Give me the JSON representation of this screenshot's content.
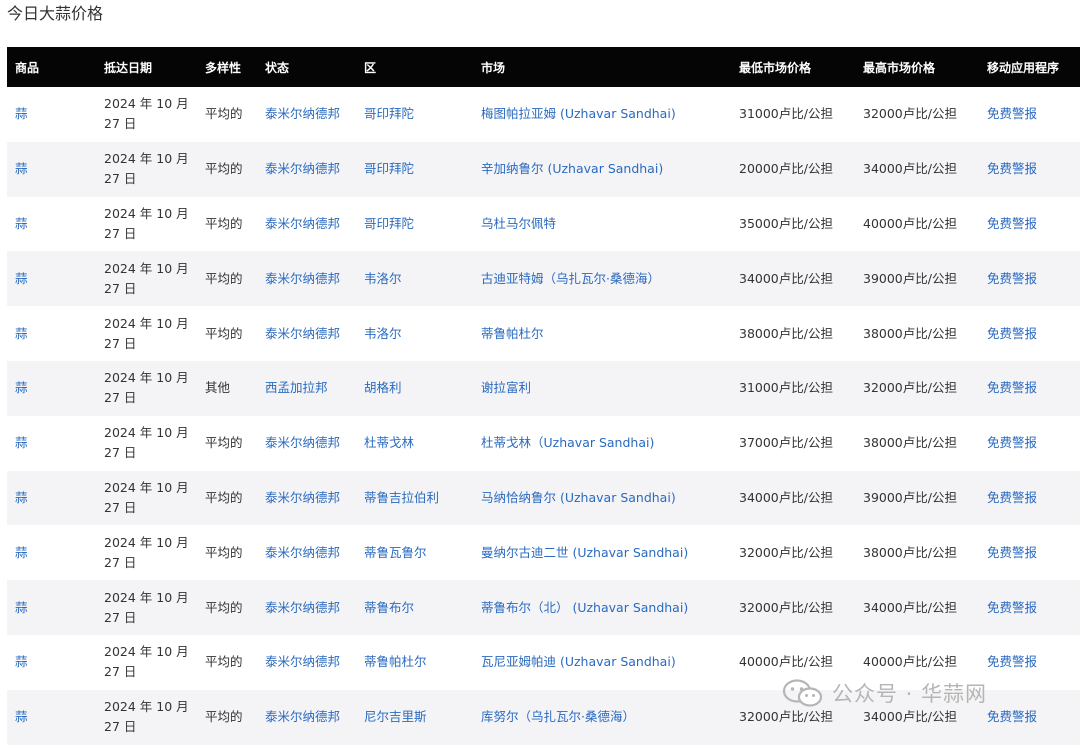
{
  "page": {
    "title": "今日大蒜价格"
  },
  "table": {
    "headers": [
      "商品",
      "抵达日期",
      "多样性",
      "状态",
      "区",
      "市场",
      "最低市场价格",
      "最高市场价格",
      "移动应用程序"
    ],
    "rows": [
      {
        "commodity": "蒜",
        "date": "2024 年 10 月 27 日",
        "variety": "平均的",
        "state": "泰米尔纳德邦",
        "district": "哥印拜陀",
        "market": "梅图帕拉亚姆 (Uzhavar Sandhai)",
        "min": "31000卢比/公担",
        "max": "32000卢比/公担",
        "app": "免费警报"
      },
      {
        "commodity": "蒜",
        "date": "2024 年 10 月 27 日",
        "variety": "平均的",
        "state": "泰米尔纳德邦",
        "district": "哥印拜陀",
        "market": "辛加纳鲁尔 (Uzhavar Sandhai)",
        "min": "20000卢比/公担",
        "max": "34000卢比/公担",
        "app": "免费警报"
      },
      {
        "commodity": "蒜",
        "date": "2024 年 10 月 27 日",
        "variety": "平均的",
        "state": "泰米尔纳德邦",
        "district": "哥印拜陀",
        "market": "乌杜马尔佩特",
        "min": "35000卢比/公担",
        "max": "40000卢比/公担",
        "app": "免费警报"
      },
      {
        "commodity": "蒜",
        "date": "2024 年 10 月 27 日",
        "variety": "平均的",
        "state": "泰米尔纳德邦",
        "district": "韦洛尔",
        "market": "古迪亚特姆（乌扎瓦尔·桑德海）",
        "min": "34000卢比/公担",
        "max": "39000卢比/公担",
        "app": "免费警报"
      },
      {
        "commodity": "蒜",
        "date": "2024 年 10 月 27 日",
        "variety": "平均的",
        "state": "泰米尔纳德邦",
        "district": "韦洛尔",
        "market": "蒂鲁帕杜尔",
        "min": "38000卢比/公担",
        "max": "38000卢比/公担",
        "app": "免费警报"
      },
      {
        "commodity": "蒜",
        "date": "2024 年 10 月 27 日",
        "variety": "其他",
        "state": "西孟加拉邦",
        "district": "胡格利",
        "market": "谢拉富利",
        "min": "31000卢比/公担",
        "max": "32000卢比/公担",
        "app": "免费警报"
      },
      {
        "commodity": "蒜",
        "date": "2024 年 10 月 27 日",
        "variety": "平均的",
        "state": "泰米尔纳德邦",
        "district": "杜蒂戈林",
        "market": "杜蒂戈林（Uzhavar Sandhai)",
        "min": "37000卢比/公担",
        "max": "38000卢比/公担",
        "app": "免费警报"
      },
      {
        "commodity": "蒜",
        "date": "2024 年 10 月 27 日",
        "variety": "平均的",
        "state": "泰米尔纳德邦",
        "district": "蒂鲁吉拉伯利",
        "market": "马纳恰纳鲁尔 (Uzhavar Sandhai)",
        "min": "34000卢比/公担",
        "max": "39000卢比/公担",
        "app": "免费警报"
      },
      {
        "commodity": "蒜",
        "date": "2024 年 10 月 27 日",
        "variety": "平均的",
        "state": "泰米尔纳德邦",
        "district": "蒂鲁瓦鲁尔",
        "market": "曼纳尔古迪二世 (Uzhavar Sandhai)",
        "min": "32000卢比/公担",
        "max": "38000卢比/公担",
        "app": "免费警报"
      },
      {
        "commodity": "蒜",
        "date": "2024 年 10 月 27 日",
        "variety": "平均的",
        "state": "泰米尔纳德邦",
        "district": "蒂鲁布尔",
        "market": "蒂鲁布尔（北） (Uzhavar Sandhai)",
        "min": "32000卢比/公担",
        "max": "34000卢比/公担",
        "app": "免费警报"
      },
      {
        "commodity": "蒜",
        "date": "2024 年 10 月 27 日",
        "variety": "平均的",
        "state": "泰米尔纳德邦",
        "district": "蒂鲁帕杜尔",
        "market": "瓦尼亚姆帕迪 (Uzhavar Sandhai)",
        "min": "40000卢比/公担",
        "max": "40000卢比/公担",
        "app": "免费警报"
      },
      {
        "commodity": "蒜",
        "date": "2024 年 10 月 27 日",
        "variety": "平均的",
        "state": "泰米尔纳德邦",
        "district": "尼尔吉里斯",
        "market": "库努尔（乌扎瓦尔·桑德海）",
        "min": "32000卢比/公担",
        "max": "34000卢比/公担",
        "app": "免费警报"
      }
    ]
  },
  "watermark": {
    "text": "公众号 · 华蒜网",
    "icon": "wechat-icon"
  }
}
